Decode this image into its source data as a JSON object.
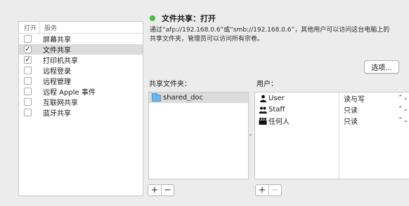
{
  "services_panel": {
    "header_open": "打开",
    "header_service": "服务",
    "items": [
      {
        "label": "屏幕共享",
        "checked": false,
        "selected": false
      },
      {
        "label": "文件共享",
        "checked": true,
        "selected": true
      },
      {
        "label": "打印机共享",
        "checked": true,
        "selected": false
      },
      {
        "label": "远程登录",
        "checked": false,
        "selected": false
      },
      {
        "label": "远程管理",
        "checked": false,
        "selected": false
      },
      {
        "label": "远程 Apple 事件",
        "checked": false,
        "selected": false
      },
      {
        "label": "互联网共享",
        "checked": false,
        "selected": false
      },
      {
        "label": "蓝牙共享",
        "checked": false,
        "selected": false
      }
    ]
  },
  "status": {
    "text": "文件共享：打开",
    "color": "#3cc23c"
  },
  "description": "通过“afp://192.168.0.6”或“smb://192.168.0.6”，其他用户可以访问这台电脑上的共享文件夹，管理员可以访问所有宗卷。",
  "options_button": "选项...",
  "shared_folders": {
    "label": "共享文件夹：",
    "items": [
      "shared_doc"
    ],
    "add": "+",
    "remove": "−"
  },
  "users": {
    "label": "用户：",
    "stepper_glyph": "⌃⌄",
    "items": [
      {
        "name": "User",
        "permission": "读与写",
        "icon": "single-user-icon"
      },
      {
        "name": "Staff",
        "permission": "只读",
        "icon": "group-icon"
      },
      {
        "name": "任何人",
        "permission": "只读",
        "icon": "everyone-icon"
      }
    ],
    "add": "+",
    "remove": "−"
  }
}
